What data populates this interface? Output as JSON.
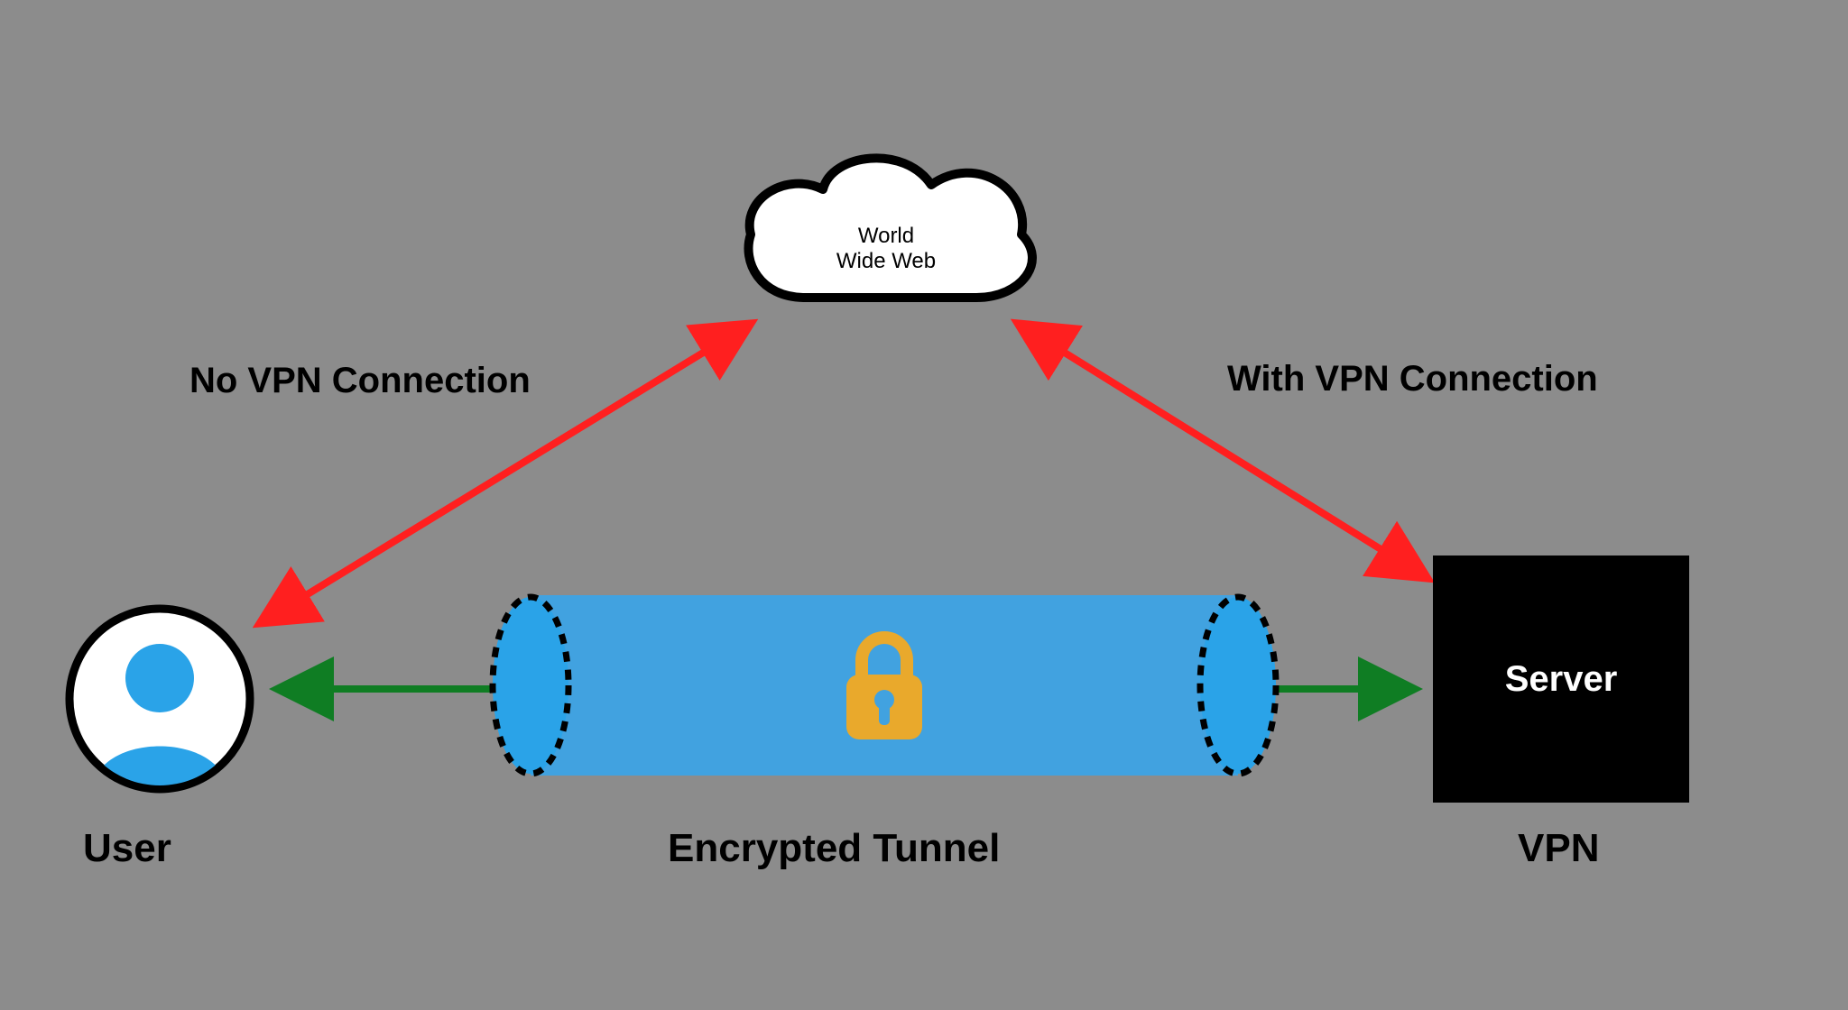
{
  "cloud": {
    "line1": "World",
    "line2": "Wide Web"
  },
  "labels": {
    "no_vpn": "No VPN Connection",
    "with_vpn": "With VPN Connection",
    "user": "User",
    "tunnel": "Encrypted Tunnel",
    "vpn": "VPN",
    "server": "Server"
  },
  "colors": {
    "arrow_red": "#ff1f1f",
    "arrow_green": "#0f7d23",
    "tunnel_blue": "#41a2e0",
    "lock_yellow": "#e9a92c",
    "user_blue": "#2aa3e8"
  },
  "icons": {
    "cloud": "cloud-icon",
    "user": "user-icon",
    "lock": "lock-icon"
  },
  "diagram": {
    "nodes": [
      "User",
      "World Wide Web",
      "Encrypted Tunnel",
      "Server (VPN)"
    ],
    "edges": [
      {
        "from": "User",
        "to": "World Wide Web",
        "label": "No VPN Connection",
        "color": "red",
        "bidirectional": true
      },
      {
        "from": "Server (VPN)",
        "to": "World Wide Web",
        "label": "With VPN Connection",
        "color": "red",
        "bidirectional": true
      },
      {
        "from": "User",
        "to": "Encrypted Tunnel",
        "color": "green",
        "bidirectional": true
      },
      {
        "from": "Encrypted Tunnel",
        "to": "Server (VPN)",
        "color": "green",
        "bidirectional": true
      }
    ]
  }
}
